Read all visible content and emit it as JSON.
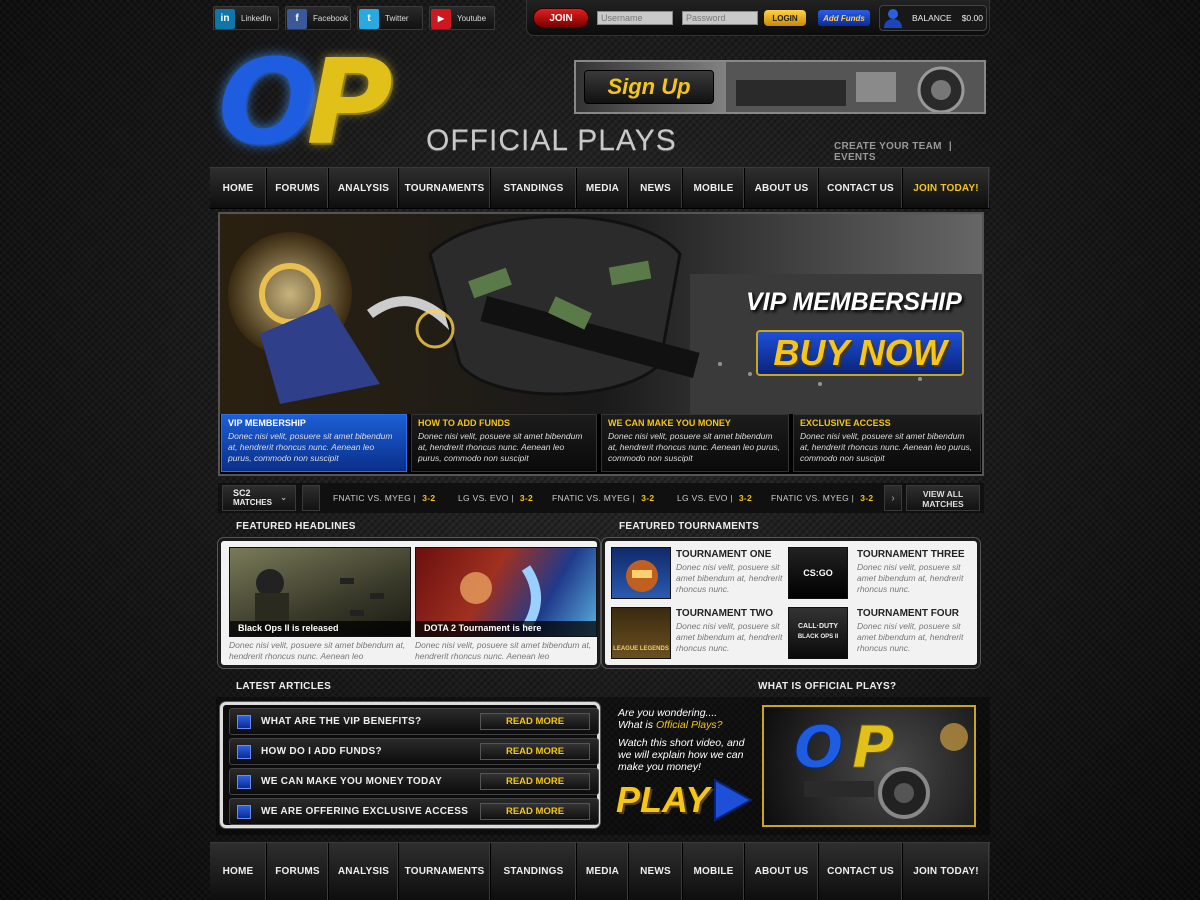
{
  "social": [
    {
      "icon": "linkedin-icon",
      "glyph": "in",
      "color": "#0e76a8",
      "label": "LinkedIn"
    },
    {
      "icon": "facebook-icon",
      "glyph": "f",
      "color": "#3b5998",
      "label": "Facebook"
    },
    {
      "icon": "twitter-icon",
      "glyph": "t",
      "color": "#2aa9e0",
      "label": "Twitter"
    },
    {
      "icon": "youtube-icon",
      "glyph": "▶",
      "color": "#cc181e",
      "label": "Youtube"
    }
  ],
  "login": {
    "join": "JOIN",
    "username_ph": "Username",
    "password_ph": "Password",
    "login": "LOGIN",
    "add_funds": "Add Funds",
    "balance_label": "BALANCE",
    "balance": "$0.00"
  },
  "logo": {
    "letters": "OP",
    "name": "OFFICIAL PLAYS"
  },
  "signup": "Sign Up",
  "header_links": [
    "CREATE YOUR TEAM",
    "|",
    "EVENTS"
  ],
  "nav": [
    "HOME",
    "FORUMS",
    "ANALYSIS",
    "TOURNAMENTS",
    "STANDINGS",
    "MEDIA",
    "NEWS",
    "MOBILE",
    "ABOUT US",
    "CONTACT US",
    "JOIN TODAY!"
  ],
  "hero": {
    "title": "VIP MEMBERSHIP",
    "cta": "BUY NOW"
  },
  "cards": [
    {
      "title": "VIP MEMBERSHIP",
      "text": "Donec nisi velit, posuere sit amet bibendum at, hendrerit rhoncus nunc. Aenean leo purus, commodo non suscipit"
    },
    {
      "title": "HOW TO ADD FUNDS",
      "text": "Donec nisi velit, posuere sit amet bibendum at, hendrerit rhoncus nunc. Aenean leo purus, commodo non suscipit"
    },
    {
      "title": "WE CAN MAKE YOU MONEY",
      "text": "Donec nisi velit, posuere sit amet bibendum at, hendrerit rhoncus nunc. Aenean leo purus, commodo non suscipit"
    },
    {
      "title": "EXCLUSIVE  ACCESS",
      "text": "Donec nisi velit, posuere sit amet bibendum at, hendrerit rhoncus nunc. Aenean leo purus, commodo non suscipit"
    }
  ],
  "ticker": {
    "game": "SC2",
    "sub": "MATCHES",
    "matches": [
      {
        "teams": "FNATIC VS. MYEG |",
        "score": "3-2"
      },
      {
        "teams": "LG VS. EVO |",
        "score": "3-2"
      },
      {
        "teams": "FNATIC VS. MYEG |",
        "score": "3-2"
      },
      {
        "teams": "LG VS. EVO |",
        "score": "3-2"
      },
      {
        "teams": "FNATIC VS. MYEG |",
        "score": "3-2"
      }
    ],
    "view_all": "VIEW ALL",
    "view_all2": "MATCHES"
  },
  "headlines": {
    "heading": "FEATURED HEADLINES",
    "items": [
      {
        "caption": "Black Ops II is released",
        "text": "Donec nisi velit, posuere sit amet bibendum at, hendrerit rhoncus nunc. Aenean leo"
      },
      {
        "caption": "DOTA 2 Tournament is here",
        "text": "Donec nisi velit, posuere sit amet bibendum at, hendrerit rhoncus nunc. Aenean leo"
      }
    ]
  },
  "tournaments": {
    "heading": "FEATURED TOURNAMENTS",
    "items": [
      {
        "title": "TOURNAMENT ONE",
        "text": "Donec nisi velit, posuere sit amet bibendum at, hendrerit rhoncus nunc."
      },
      {
        "title": "TOURNAMENT THREE",
        "text": "Donec nisi velit, posuere sit amet bibendum at, hendrerit rhoncus nunc."
      },
      {
        "title": "TOURNAMENT TWO",
        "text": "Donec nisi velit, posuere sit amet bibendum at, hendrerit rhoncus nunc."
      },
      {
        "title": "TOURNAMENT FOUR",
        "text": "Donec nisi velit, posuere sit amet bibendum at, hendrerit rhoncus nunc."
      }
    ],
    "thumb_labels": [
      "CS:GO",
      "CALL·DUTY",
      "BLACK OPS II",
      "LEAGUE LEGENDS"
    ]
  },
  "articles": {
    "heading": "LATEST ARTICLES",
    "read_more": "READ MORE",
    "items": [
      "WHAT ARE THE VIP BENEFITS?",
      "HOW DO I ADD FUNDS?",
      "WE CAN MAKE YOU MONEY TODAY",
      "WE ARE OFFERING EXCLUSIVE ACCESS"
    ]
  },
  "what": {
    "heading": "WHAT IS OFFICIAL PLAYS?",
    "line1": "Are you wondering....",
    "line2a": "What is ",
    "line2b": "Official Plays?",
    "line3": "Watch this short video, and we will explain how we can make you money!",
    "play": "PLAY"
  }
}
